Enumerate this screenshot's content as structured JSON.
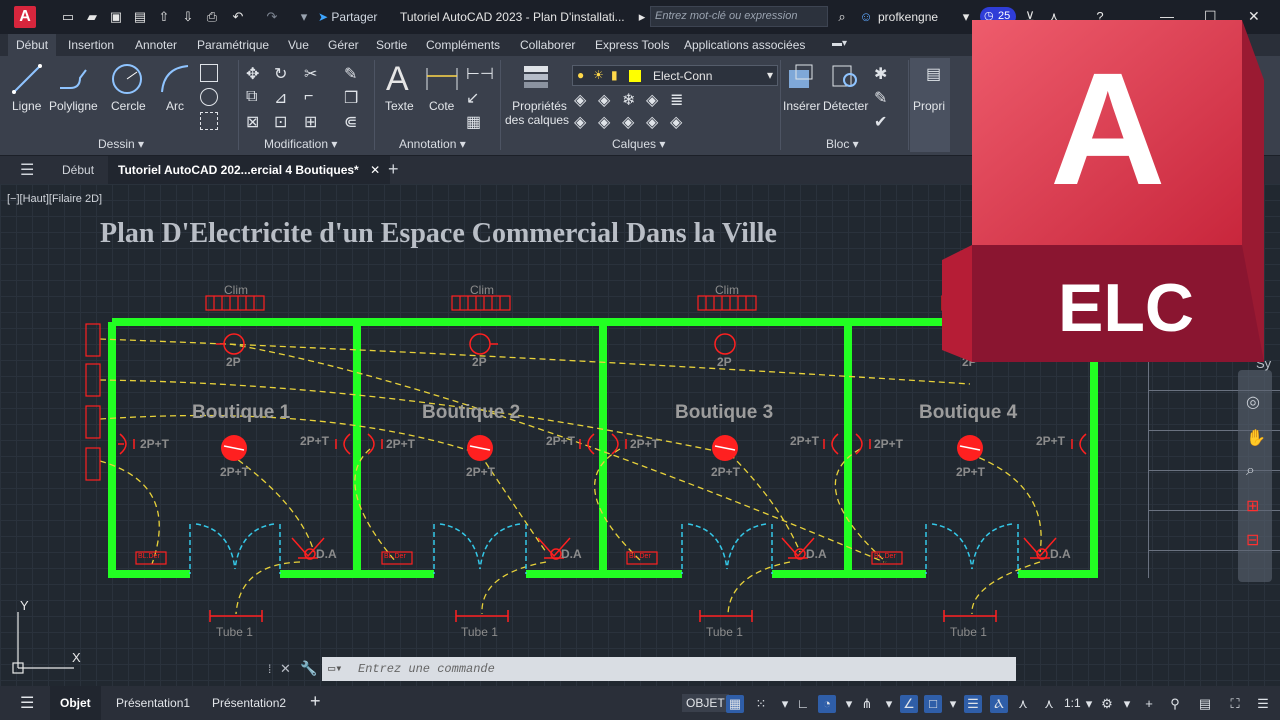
{
  "titlebar": {
    "app_logo": "A",
    "share_label": "Partager",
    "title": "Tutoriel AutoCAD 2023 - Plan D'installati...",
    "search_placeholder": "Entrez mot-clé ou expression",
    "username": "profkengne",
    "timer_count": "25"
  },
  "ribbon_tabs": [
    "Début",
    "Insertion",
    "Annoter",
    "Paramétrique",
    "Vue",
    "Gérer",
    "Sortie",
    "Compléments",
    "Collaborer",
    "Express Tools",
    "Applications associées"
  ],
  "ribbon": {
    "draw": {
      "panel": "Dessin",
      "tools": [
        "Ligne",
        "Polyligne",
        "Cercle",
        "Arc"
      ]
    },
    "modify": {
      "panel": "Modification"
    },
    "annotation": {
      "panel": "Annotation",
      "tools": [
        "Texte",
        "Cote"
      ]
    },
    "layers": {
      "panel": "Calques",
      "props_line1": "Propriétés",
      "props_line2": "des calques",
      "current_layer": "Elect-Conn",
      "layer_color": "#ffff00"
    },
    "block": {
      "panel": "Bloc",
      "tools": [
        "Insérer",
        "Détecter"
      ]
    },
    "properties": {
      "label": "Propri"
    }
  },
  "doc_tabs": {
    "start": "Début",
    "active": "Tutoriel AutoCAD 202...ercial 4 Boutiques*"
  },
  "canvas": {
    "viewport_label": "[−][Haut][Filaire 2D]",
    "plan_title": "Plan D'Electricite d'un Espace Commercial Dans la Ville",
    "clim_label": "Clim",
    "shop_names": [
      "Boutique 1",
      "Boutique 2",
      "Boutique 3",
      "Boutique 4"
    ],
    "socket_2p": "2P",
    "socket_2pt": "2P+T",
    "da_label": "D.A",
    "tube_label": "Tube 1",
    "disjoncteur_label": "BL.Der",
    "axis_y": "Y",
    "axis_x": "X",
    "wall_color": "#22ff22",
    "wire_color": "#e8d23a",
    "symbol_color": "#ff2020",
    "door_color": "#34c8e8"
  },
  "command": {
    "placeholder": "Entrez une commande"
  },
  "status": {
    "tabs": [
      "Objet",
      "Présentation1",
      "Présentation2"
    ],
    "mode": "OBJET",
    "scale": "1:1"
  },
  "brand": {
    "letter": "A",
    "text": "ELC",
    "color_top": "#e8475a",
    "color_bottom": "#8a1530"
  },
  "navbar": {
    "label": "Sy"
  }
}
